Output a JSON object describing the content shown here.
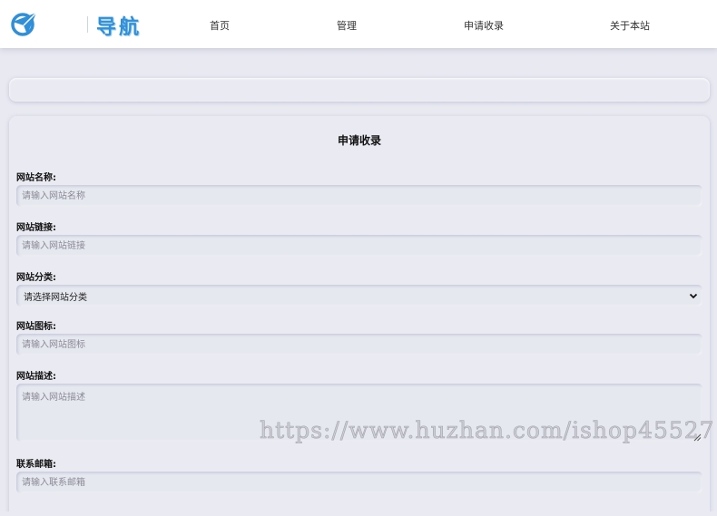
{
  "header": {
    "logo_text": "导航",
    "nav": [
      {
        "label": "首页"
      },
      {
        "label": "管理"
      },
      {
        "label": "申请收录"
      },
      {
        "label": "关于本站"
      }
    ]
  },
  "form": {
    "title": "申请收录",
    "fields": {
      "name": {
        "label": "网站名称:",
        "placeholder": "请输入网站名称"
      },
      "url": {
        "label": "网站链接:",
        "placeholder": "请输入网站链接"
      },
      "category": {
        "label": "网站分类:",
        "selected": "请选择网站分类"
      },
      "icon": {
        "label": "网站图标:",
        "placeholder": "请输入网站图标"
      },
      "description": {
        "label": "网站描述:",
        "placeholder": "请输入网站描述"
      },
      "email": {
        "label": "联系邮箱:",
        "placeholder": "请输入联系邮箱"
      }
    }
  },
  "watermark": "https://www.huzhan.com/ishop45527",
  "colors": {
    "accent": "#2f8fd8",
    "background": "#e8e9f1"
  },
  "icons": {
    "logo": "paper-plane-globe-icon",
    "select": "chevron-down-icon",
    "resize": "resize-grip-icon"
  }
}
